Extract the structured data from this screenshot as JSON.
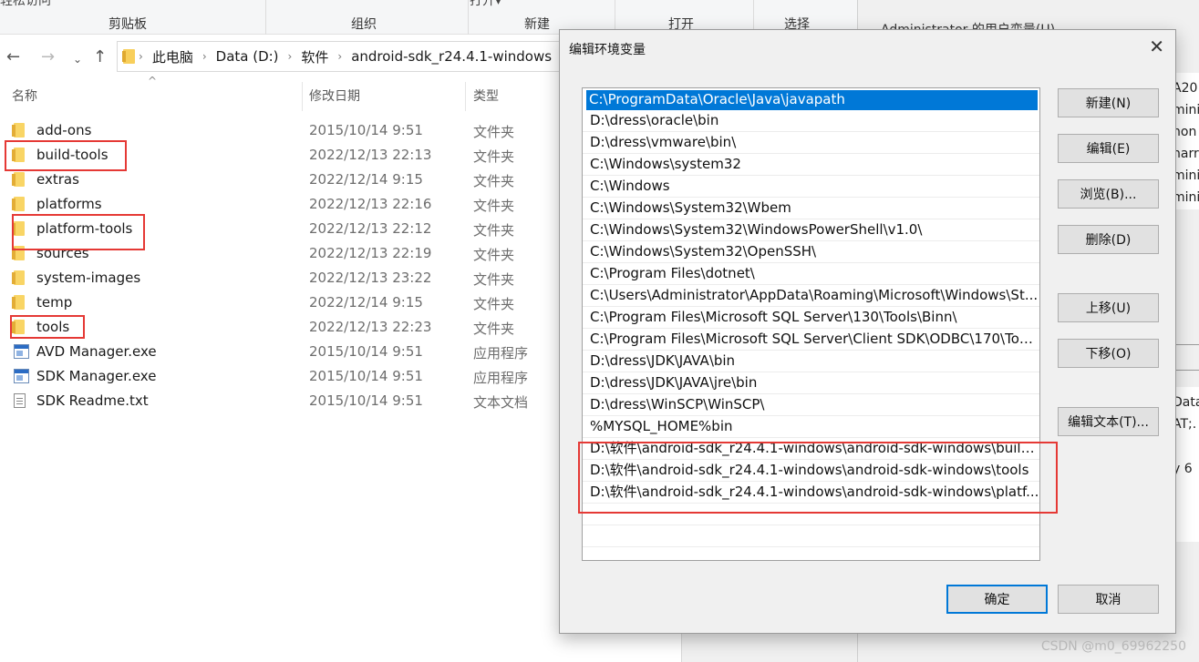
{
  "explorer": {
    "ribbon": {
      "cut_text": "轻松访问",
      "cut_text2": "打开▾",
      "groups": [
        "剪贴板",
        "组织",
        "新建",
        "打开",
        "选择"
      ]
    },
    "breadcrumb": [
      "此电脑",
      "Data (D:)",
      "软件",
      "android-sdk_r24.4.1-windows"
    ],
    "columns": {
      "name": "名称",
      "date": "修改日期",
      "type": "类型"
    },
    "files": [
      {
        "name": "add-ons",
        "date": "2015/10/14 9:51",
        "type": "文件夹",
        "icon": "folder-icon"
      },
      {
        "name": "build-tools",
        "date": "2022/12/13 22:13",
        "type": "文件夹",
        "icon": "folder-icon"
      },
      {
        "name": "extras",
        "date": "2022/12/14 9:15",
        "type": "文件夹",
        "icon": "folder-icon"
      },
      {
        "name": "platforms",
        "date": "2022/12/13 22:16",
        "type": "文件夹",
        "icon": "folder-icon"
      },
      {
        "name": "platform-tools",
        "date": "2022/12/13 22:12",
        "type": "文件夹",
        "icon": "folder-icon"
      },
      {
        "name": "sources",
        "date": "2022/12/13 22:19",
        "type": "文件夹",
        "icon": "folder-icon"
      },
      {
        "name": "system-images",
        "date": "2022/12/13 23:22",
        "type": "文件夹",
        "icon": "folder-icon"
      },
      {
        "name": "temp",
        "date": "2022/12/14 9:15",
        "type": "文件夹",
        "icon": "folder-icon"
      },
      {
        "name": "tools",
        "date": "2022/12/13 22:23",
        "type": "文件夹",
        "icon": "folder-icon"
      },
      {
        "name": "AVD Manager.exe",
        "date": "2015/10/14 9:51",
        "type": "应用程序",
        "icon": "exe-icon"
      },
      {
        "name": "SDK Manager.exe",
        "date": "2015/10/14 9:51",
        "type": "应用程序",
        "icon": "exe-icon"
      },
      {
        "name": "SDK Readme.txt",
        "date": "2015/10/14 9:51",
        "type": "文本文档",
        "icon": "txt-icon"
      }
    ]
  },
  "background_dialog": {
    "title": "Administrator 的用户变量(U)",
    "fragments": [
      "A20",
      "mini",
      "hon",
      "harr",
      "mini",
      "mini",
      "Data\\",
      "AT;.",
      "y 6"
    ]
  },
  "dialog": {
    "title": "编辑环境变量",
    "paths": [
      "C:\\ProgramData\\Oracle\\Java\\javapath",
      "D:\\dress\\oracle\\bin",
      "D:\\dress\\vmware\\bin\\",
      "C:\\Windows\\system32",
      "C:\\Windows",
      "C:\\Windows\\System32\\Wbem",
      "C:\\Windows\\System32\\WindowsPowerShell\\v1.0\\",
      "C:\\Windows\\System32\\OpenSSH\\",
      "C:\\Program Files\\dotnet\\",
      "C:\\Users\\Administrator\\AppData\\Roaming\\Microsoft\\Windows\\St...",
      "C:\\Program Files\\Microsoft SQL Server\\130\\Tools\\Binn\\",
      "C:\\Program Files\\Microsoft SQL Server\\Client SDK\\ODBC\\170\\Too...",
      "D:\\dress\\JDK\\JAVA\\bin",
      "D:\\dress\\JDK\\JAVA\\jre\\bin",
      "D:\\dress\\WinSCP\\WinSCP\\",
      "%MYSQL_HOME%bin",
      "D:\\软件\\android-sdk_r24.4.1-windows\\android-sdk-windows\\build...",
      "D:\\软件\\android-sdk_r24.4.1-windows\\android-sdk-windows\\tools",
      "D:\\软件\\android-sdk_r24.4.1-windows\\android-sdk-windows\\platf..."
    ],
    "buttons": {
      "new": "新建(N)",
      "edit": "编辑(E)",
      "browse": "浏览(B)...",
      "delete": "删除(D)",
      "move_up": "上移(U)",
      "move_down": "下移(O)",
      "edit_text": "编辑文本(T)...",
      "ok": "确定",
      "cancel": "取消"
    },
    "close_glyph": "✕"
  },
  "watermark": "CSDN @m0_69962250",
  "colors": {
    "selection": "#0078d7",
    "highlight_box": "#e53935",
    "folder": "#f9d565"
  }
}
